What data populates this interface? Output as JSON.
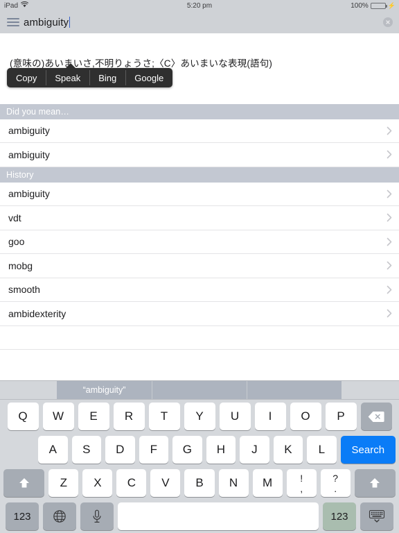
{
  "statusbar": {
    "device": "iPad",
    "wifi_icon": "wifi-icon",
    "time": "5:20 pm",
    "battery_percent": "100%",
    "battery_level": 100,
    "charging": true,
    "background": "#cfd2d6"
  },
  "searchbar": {
    "menu_icon": "hamburger-menu-icon",
    "query": "ambiguity",
    "clear_icon": "clear-circle-icon",
    "background": "#cfd2d6"
  },
  "edit_popup": {
    "items": [
      {
        "label": "Copy",
        "name": "copy"
      },
      {
        "label": "Speak",
        "name": "speak"
      },
      {
        "label": "Bing",
        "name": "bing"
      },
      {
        "label": "Google",
        "name": "google"
      }
    ],
    "background": "#2f2f2f"
  },
  "definition": {
    "text": "(意味の)あいまいさ,不明りょうさ;〈C〉あいまいな表現(語句)"
  },
  "sections": [
    {
      "header": "Did you mean…",
      "name": "did-you-mean",
      "rows": [
        {
          "label": "ambiguity"
        },
        {
          "label": "ambiguity"
        }
      ]
    },
    {
      "header": "History",
      "name": "history",
      "rows": [
        {
          "label": "ambiguity"
        },
        {
          "label": "vdt"
        },
        {
          "label": "goo"
        },
        {
          "label": "mobg"
        },
        {
          "label": "smooth"
        },
        {
          "label": "ambidexterity"
        }
      ]
    }
  ],
  "disclosure_icon": "chevron-right-icon",
  "keyboard": {
    "suggestions": [
      {
        "label": "“ambiguity”",
        "filled": true
      },
      {
        "label": "",
        "filled": true
      },
      {
        "label": "",
        "filled": true
      }
    ],
    "row1": [
      "Q",
      "W",
      "E",
      "R",
      "T",
      "Y",
      "U",
      "I",
      "O",
      "P"
    ],
    "backspace_icon": "backspace-icon",
    "row2": [
      "A",
      "S",
      "D",
      "F",
      "G",
      "H",
      "J",
      "K",
      "L"
    ],
    "search_key": "Search",
    "shift_icon": "shift-arrow-icon",
    "row3": [
      "Z",
      "X",
      "C",
      "V",
      "B",
      "N",
      "M"
    ],
    "punct": [
      {
        "top": "!",
        "bottom": ","
      },
      {
        "top": "?",
        "bottom": "."
      }
    ],
    "numbers_left": "123",
    "globe_icon": "globe-icon",
    "mic_icon": "microphone-icon",
    "space_label": "",
    "numbers_right": "123",
    "hide_keyboard_icon": "hide-keyboard-icon",
    "accent_blue": "#0a7cf7",
    "key_background": "#ffffff",
    "keyboard_background": "#d5d8dc"
  }
}
